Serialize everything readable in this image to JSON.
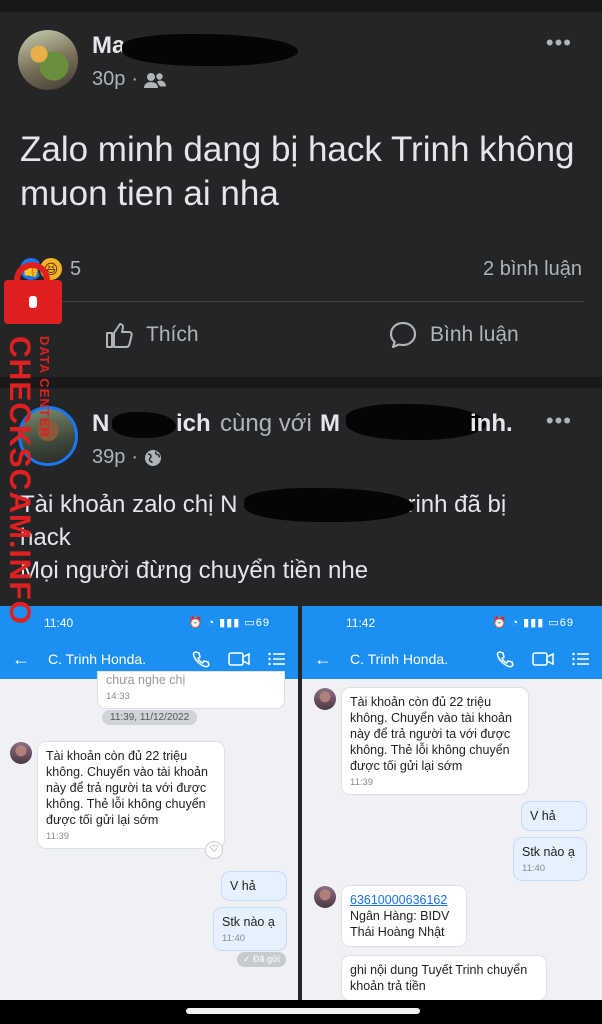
{
  "post1": {
    "author": "Ma",
    "time": "30p",
    "text": "Zalo minh dang bị hack Trinh không muon tien ai nha",
    "reaction_count": "5",
    "comments": "2 bình luận",
    "like_label": "Thích",
    "comment_label": "Bình luận"
  },
  "post2": {
    "author": "N",
    "author_tail": "ich",
    "with": "cùng với",
    "tagged": "M",
    "tagged_tail": "inh.",
    "time": "39p",
    "line1": "Tài khoản zalo chị N",
    "line1_tail": "rinh đã bị",
    "line2": "hack",
    "line3": "Mọi người đừng chuyển tiền nhe"
  },
  "watermark": {
    "main": "CHECKSCAM.INFO",
    "sub": "DATA CENTER"
  },
  "shot1": {
    "clock": "11:40",
    "battery": "69",
    "contact": "C. Trinh Honda.",
    "partial_msg": "chưa nghe chị",
    "partial_time": "14:33",
    "date_chip": "11:39, 11/12/2022",
    "msg1": "Tài khoản còn đủ 22 triệu không. Chuyển vào tài khoản này để trả người ta với được không. Thẻ lỗi không chuyển được tối gửi lại sớm",
    "msg1_time": "11:39",
    "out1": "V hả",
    "out2": "Stk nào ạ",
    "out2_time": "11:40",
    "sent_label": "✓ Đã gửi"
  },
  "shot2": {
    "clock": "11:42",
    "battery": "69",
    "contact": "C. Trinh Honda.",
    "msg1": "Tài khoản còn đủ 22 triệu không. Chuyển vào tài khoản này để trả người ta với được không. Thẻ lỗi không chuyển được tối gửi lại sớm",
    "msg1_time": "11:39",
    "out1": "V hả",
    "out2": "Stk nào ạ",
    "out2_time": "11:40",
    "acct_number": "63610000636162",
    "bank": "Ngân Hàng: BIDV",
    "acct_name": "Thái Hoàng Nhật",
    "msg3": "ghi nội dung Tuyết Trinh chuyển khoản trả tiền"
  },
  "icons": {
    "more": "•••",
    "friends": "friends-icon",
    "globe": "globe-icon",
    "like": "thumbs-up-icon",
    "comment": "comment-bubble-icon",
    "back": "←",
    "call": "phone-icon",
    "video": "video-icon",
    "menu": "list-icon"
  },
  "colors": {
    "bg": "#18191a",
    "card": "#242526",
    "zalo_blue": "#1c8ff3",
    "watermark_red": "#e02020"
  }
}
